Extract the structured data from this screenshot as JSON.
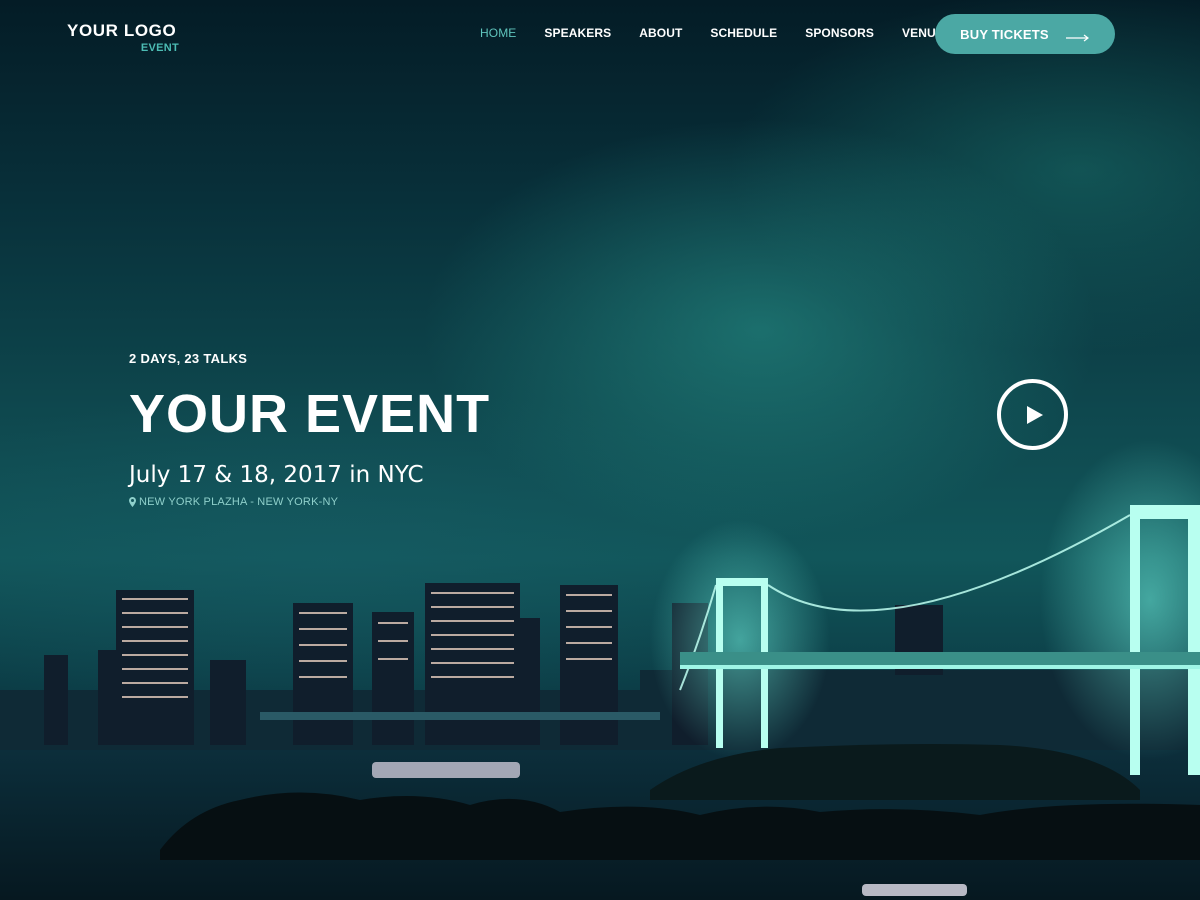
{
  "header": {
    "logo_main": "YOUR LOGO",
    "logo_sub": "EVENT",
    "nav": [
      {
        "label": "HOME",
        "active": true
      },
      {
        "label": "SPEAKERS",
        "active": false
      },
      {
        "label": "ABOUT",
        "active": false
      },
      {
        "label": "SCHEDULE",
        "active": false
      },
      {
        "label": "SPONSORS",
        "active": false
      },
      {
        "label": "VENUE",
        "active": false
      }
    ],
    "cta_label": "BUY TICKETS",
    "cta_icon": "arrow-right-icon"
  },
  "hero": {
    "tagline": "2 DAYS, 23 TALKS",
    "title": "YOUR EVENT",
    "date": "July 17 & 18, 2017 in NYC",
    "venue": "NEW YORK PLAZHA - NEW YORK-NY",
    "venue_icon": "map-pin-icon",
    "play_icon": "play-icon"
  },
  "colors": {
    "accent": "#4ba8a4",
    "nav_active": "#5fc4bc",
    "venue_text": "#8fd0cb"
  }
}
